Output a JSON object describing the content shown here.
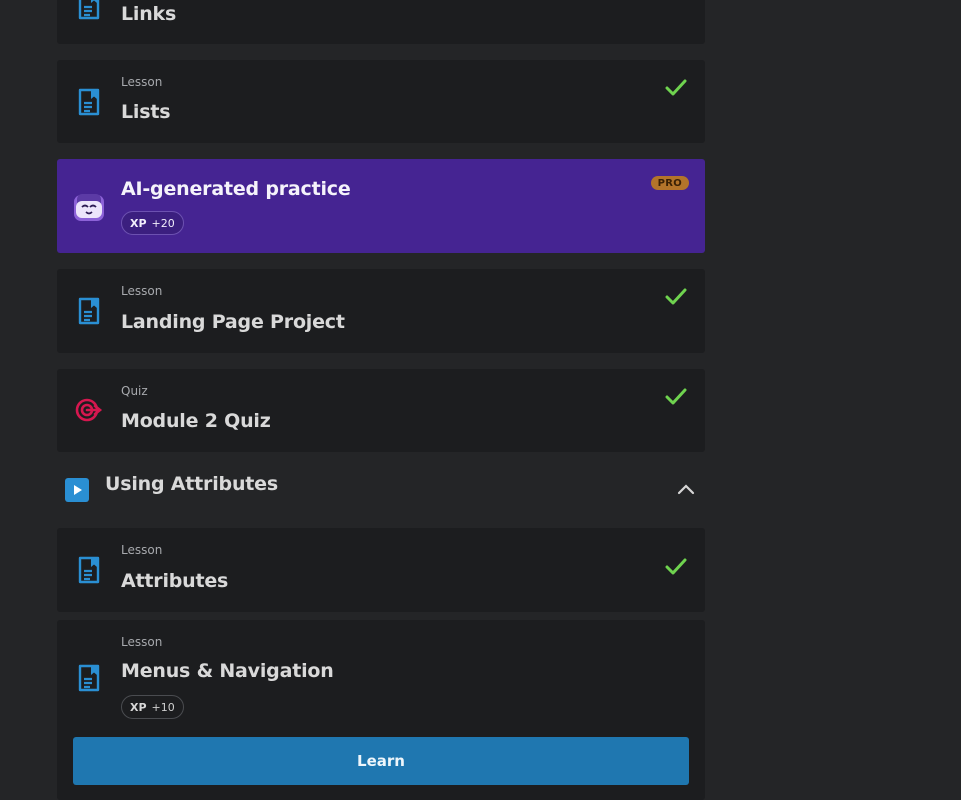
{
  "items": [
    {
      "kind": "",
      "title": "Links"
    },
    {
      "kind": "Lesson",
      "title": "Lists"
    },
    {
      "kind": "",
      "title": "AI-generated practice",
      "badge": "PRO",
      "xp_label": "XP",
      "xp_value": "+20"
    },
    {
      "kind": "Lesson",
      "title": "Landing Page Project"
    },
    {
      "kind": "Quiz",
      "title": "Module 2 Quiz"
    },
    {
      "kind": "Lesson",
      "title": "Attributes"
    },
    {
      "kind": "Lesson",
      "title": "Menus & Navigation",
      "xp_label": "XP",
      "xp_value": "+10",
      "button": "Learn"
    }
  ],
  "section": {
    "title": "Using Attributes",
    "expanded": true
  },
  "colors": {
    "background": "#242527",
    "card": "#1c1d1f",
    "ai_card": "#452492",
    "pro_badge": "#b3742a",
    "lesson_icon": "#2a8fd3",
    "quiz_icon": "#d6174f",
    "check": "#6fd34f",
    "learn_button": "#1f77b0"
  }
}
